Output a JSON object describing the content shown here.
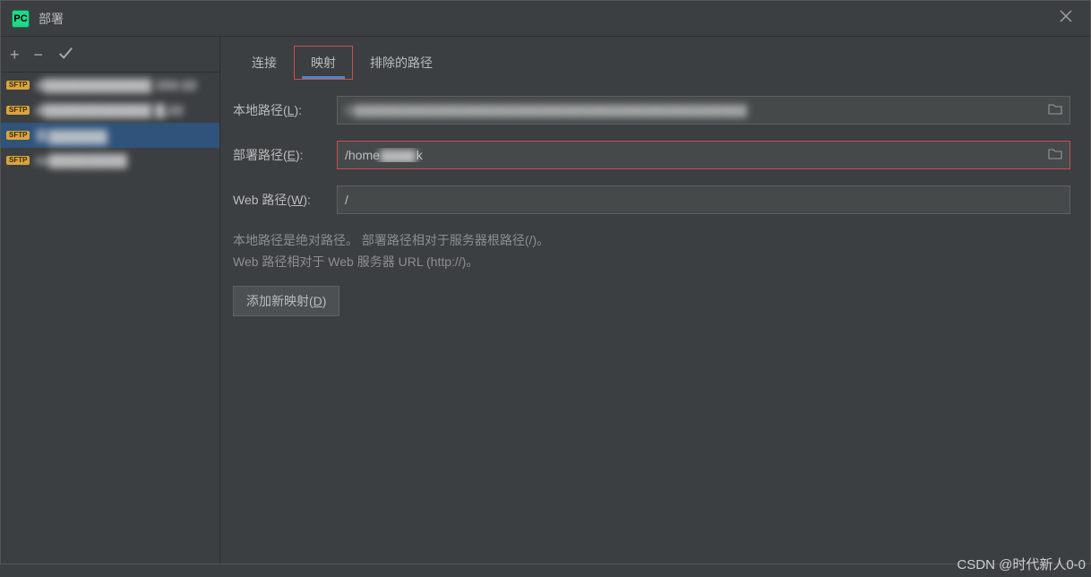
{
  "title": "部署",
  "toolbar": {
    "add_tip": "+",
    "remove_tip": "−",
    "apply_tip": "✓"
  },
  "servers": [
    {
      "protocol": "SFTP",
      "name": "d▓▓▓▓▓▓▓▓▓▓▓ 153:22",
      "selected": false
    },
    {
      "protocol": "SFTP",
      "name": "d▓▓▓▓▓▓▓▓▓▓▓ ▓.22",
      "selected": false
    },
    {
      "protocol": "SFTP",
      "name": "实▓▓▓▓▓▓",
      "selected": true
    },
    {
      "protocol": "SFTP",
      "name": "ro▓▓▓▓▓▓▓▓",
      "selected": false
    }
  ],
  "tabs": {
    "connection": "连接",
    "mapping": "映射",
    "excluded": "排除的路径",
    "active": "mapping"
  },
  "form": {
    "local_label_prefix": "本地路径(",
    "local_label_accel": "L",
    "local_label_suffix": "):",
    "local_value": "C▓▓▓▓▓▓▓▓▓▓▓▓▓▓▓▓▓▓▓▓▓▓▓▓▓▓▓▓▓▓▓▓▓▓▓▓▓▓▓▓▓▓▓",
    "deploy_label_prefix": "部署路径(",
    "deploy_label_accel": "E",
    "deploy_label_suffix": "):",
    "deploy_value_pre": "/home",
    "deploy_value_mid": "▓▓▓▓",
    "deploy_value_post": "k",
    "web_label_prefix": "Web 路径(",
    "web_label_accel": "W",
    "web_label_suffix": "):",
    "web_value": "/"
  },
  "help": {
    "line1": "本地路径是绝对路径。 部署路径相对于服务器根路径(/)。",
    "line2": "Web 路径相对于 Web 服务器 URL (http://)。"
  },
  "add_mapping_prefix": "添加新映射(",
  "add_mapping_accel": "D",
  "add_mapping_suffix": ")",
  "watermark": "CSDN @时代新人0-0"
}
